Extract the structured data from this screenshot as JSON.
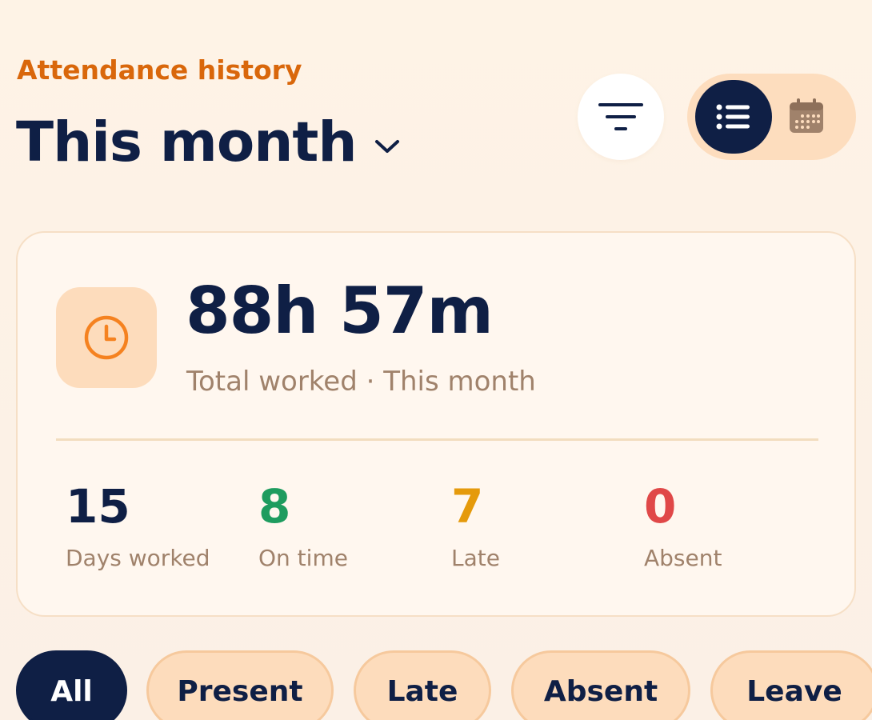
{
  "header": {
    "subtitle": "Attendance history",
    "title": "This month"
  },
  "icons": {
    "chevron": "chevron-down-icon",
    "filter": "filter-icon",
    "list_view": "list-icon",
    "calendar_view": "calendar-icon",
    "clock": "clock-icon"
  },
  "summary": {
    "total": "88h 57m",
    "caption": "Total worked · This month",
    "stats": [
      {
        "value": "15",
        "label": "Days worked",
        "color": "#0F1F45"
      },
      {
        "value": "8",
        "label": "On time",
        "color": "#1E9C5F"
      },
      {
        "value": "7",
        "label": "Late",
        "color": "#E59A0B"
      },
      {
        "value": "0",
        "label": "Absent",
        "color": "#E04848"
      }
    ]
  },
  "filters": {
    "chips": [
      "All",
      "Present",
      "Late",
      "Absent",
      "Leave"
    ],
    "active": "All"
  },
  "colors": {
    "accent": "#D9670B",
    "navy": "#0F1F45",
    "peach": "#FDDCBC",
    "clock": "#F58220"
  }
}
